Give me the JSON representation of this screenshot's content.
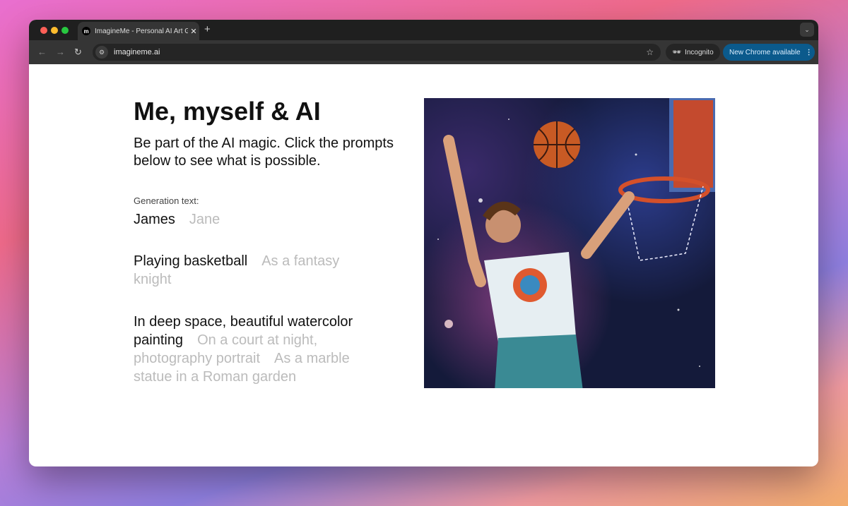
{
  "browser": {
    "tab_title": "ImagineMe - Personal AI Art Generator",
    "favicon": "m",
    "new_tab": "+",
    "url": "imagineme.ai",
    "incognito": "Incognito",
    "update": "New Chrome available"
  },
  "page": {
    "title": "Me, myself & AI",
    "subtitle": "Be part of the AI magic. Click the prompts below to see what is possible.",
    "generation_label": "Generation text:",
    "groups": [
      {
        "options": [
          {
            "label": "James",
            "selected": true
          },
          {
            "label": "Jane",
            "selected": false
          }
        ]
      },
      {
        "options": [
          {
            "label": "Playing basketball",
            "selected": true
          },
          {
            "label": "As a fantasy knight",
            "selected": false
          }
        ]
      },
      {
        "options": [
          {
            "label": "In deep space, beautiful watercolor painting",
            "selected": true
          },
          {
            "label": "On a court at night, photography portrait",
            "selected": false
          },
          {
            "label": "As a marble statue in a Roman garden",
            "selected": false
          }
        ]
      }
    ],
    "image_alt": "Watercolor painting of a man dunking a basketball in deep space"
  },
  "colors": {
    "selected": "#111111",
    "unselected": "#bbbbbb",
    "update_button": "#0b5a8c"
  }
}
